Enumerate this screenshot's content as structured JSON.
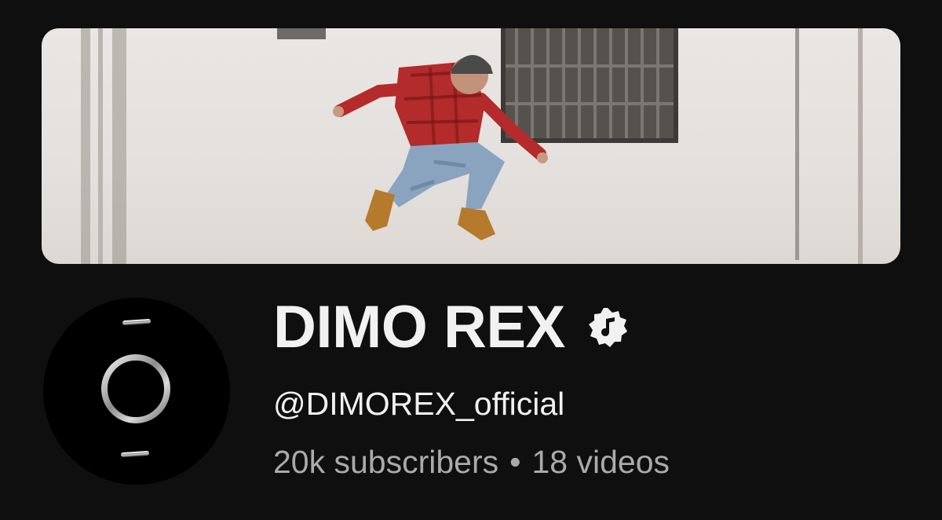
{
  "banner": {
    "alt": "Channel banner: person jumping in front of a white wall"
  },
  "avatar": {
    "alt": "Channel avatar: chrome cross-circle emblem"
  },
  "channel": {
    "name": "DIMO REX",
    "badge_icon": "music-note-verified-icon",
    "handle": "@DIMOREX_official",
    "subscribers": "20k subscribers",
    "separator": "•",
    "videos": "18 videos"
  },
  "colors": {
    "background": "#0f0f0f",
    "primary_text": "#f1f1f1",
    "secondary_text": "#aaaaaa"
  }
}
